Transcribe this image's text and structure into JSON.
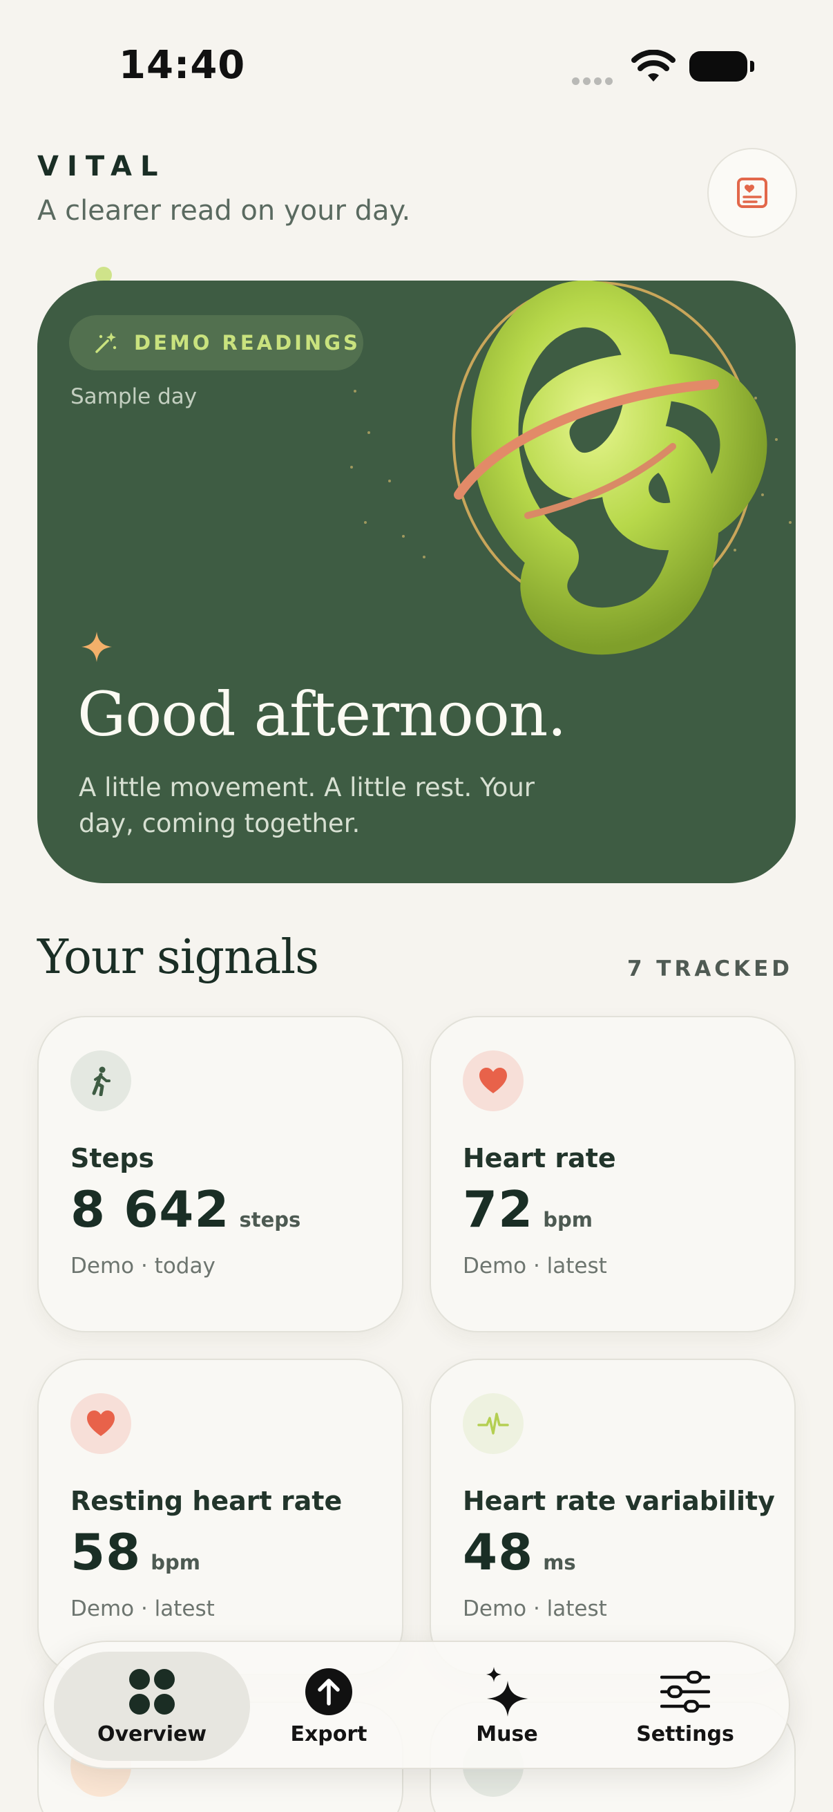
{
  "status_bar": {
    "time": "14:40"
  },
  "header": {
    "brand": "VITAL",
    "tagline": "A clearer read on your day.",
    "journal_icon": "journal-icon"
  },
  "hero": {
    "badge": "DEMO READINGS",
    "subtitle": "Sample day",
    "title": "Good afternoon.",
    "body": "A little movement. A little rest. Your day, coming together.",
    "background_color": "#3e5c43",
    "accent_color": "#c9e27e"
  },
  "signals": {
    "title": "Your signals",
    "count_label": "7 TRACKED",
    "cards": [
      {
        "label": "Steps",
        "value": "8 642",
        "unit": "steps",
        "meta": "Demo · today",
        "icon": "walking-icon"
      },
      {
        "label": "Heart rate",
        "value": "72",
        "unit": "bpm",
        "meta": "Demo · latest",
        "icon": "heart-icon"
      },
      {
        "label": "Resting heart rate",
        "value": "58",
        "unit": "bpm",
        "meta": "Demo · latest",
        "icon": "heart-icon"
      },
      {
        "label": "Heart rate variability",
        "value": "48",
        "unit": "ms",
        "meta": "Demo · latest",
        "icon": "pulse-icon"
      }
    ]
  },
  "tab_bar": {
    "tabs": [
      {
        "label": "Overview",
        "icon": "grid-icon",
        "active": true
      },
      {
        "label": "Export",
        "icon": "upload-icon",
        "active": false
      },
      {
        "label": "Muse",
        "icon": "sparkles-icon",
        "active": false
      },
      {
        "label": "Settings",
        "icon": "sliders-icon",
        "active": false
      }
    ]
  }
}
